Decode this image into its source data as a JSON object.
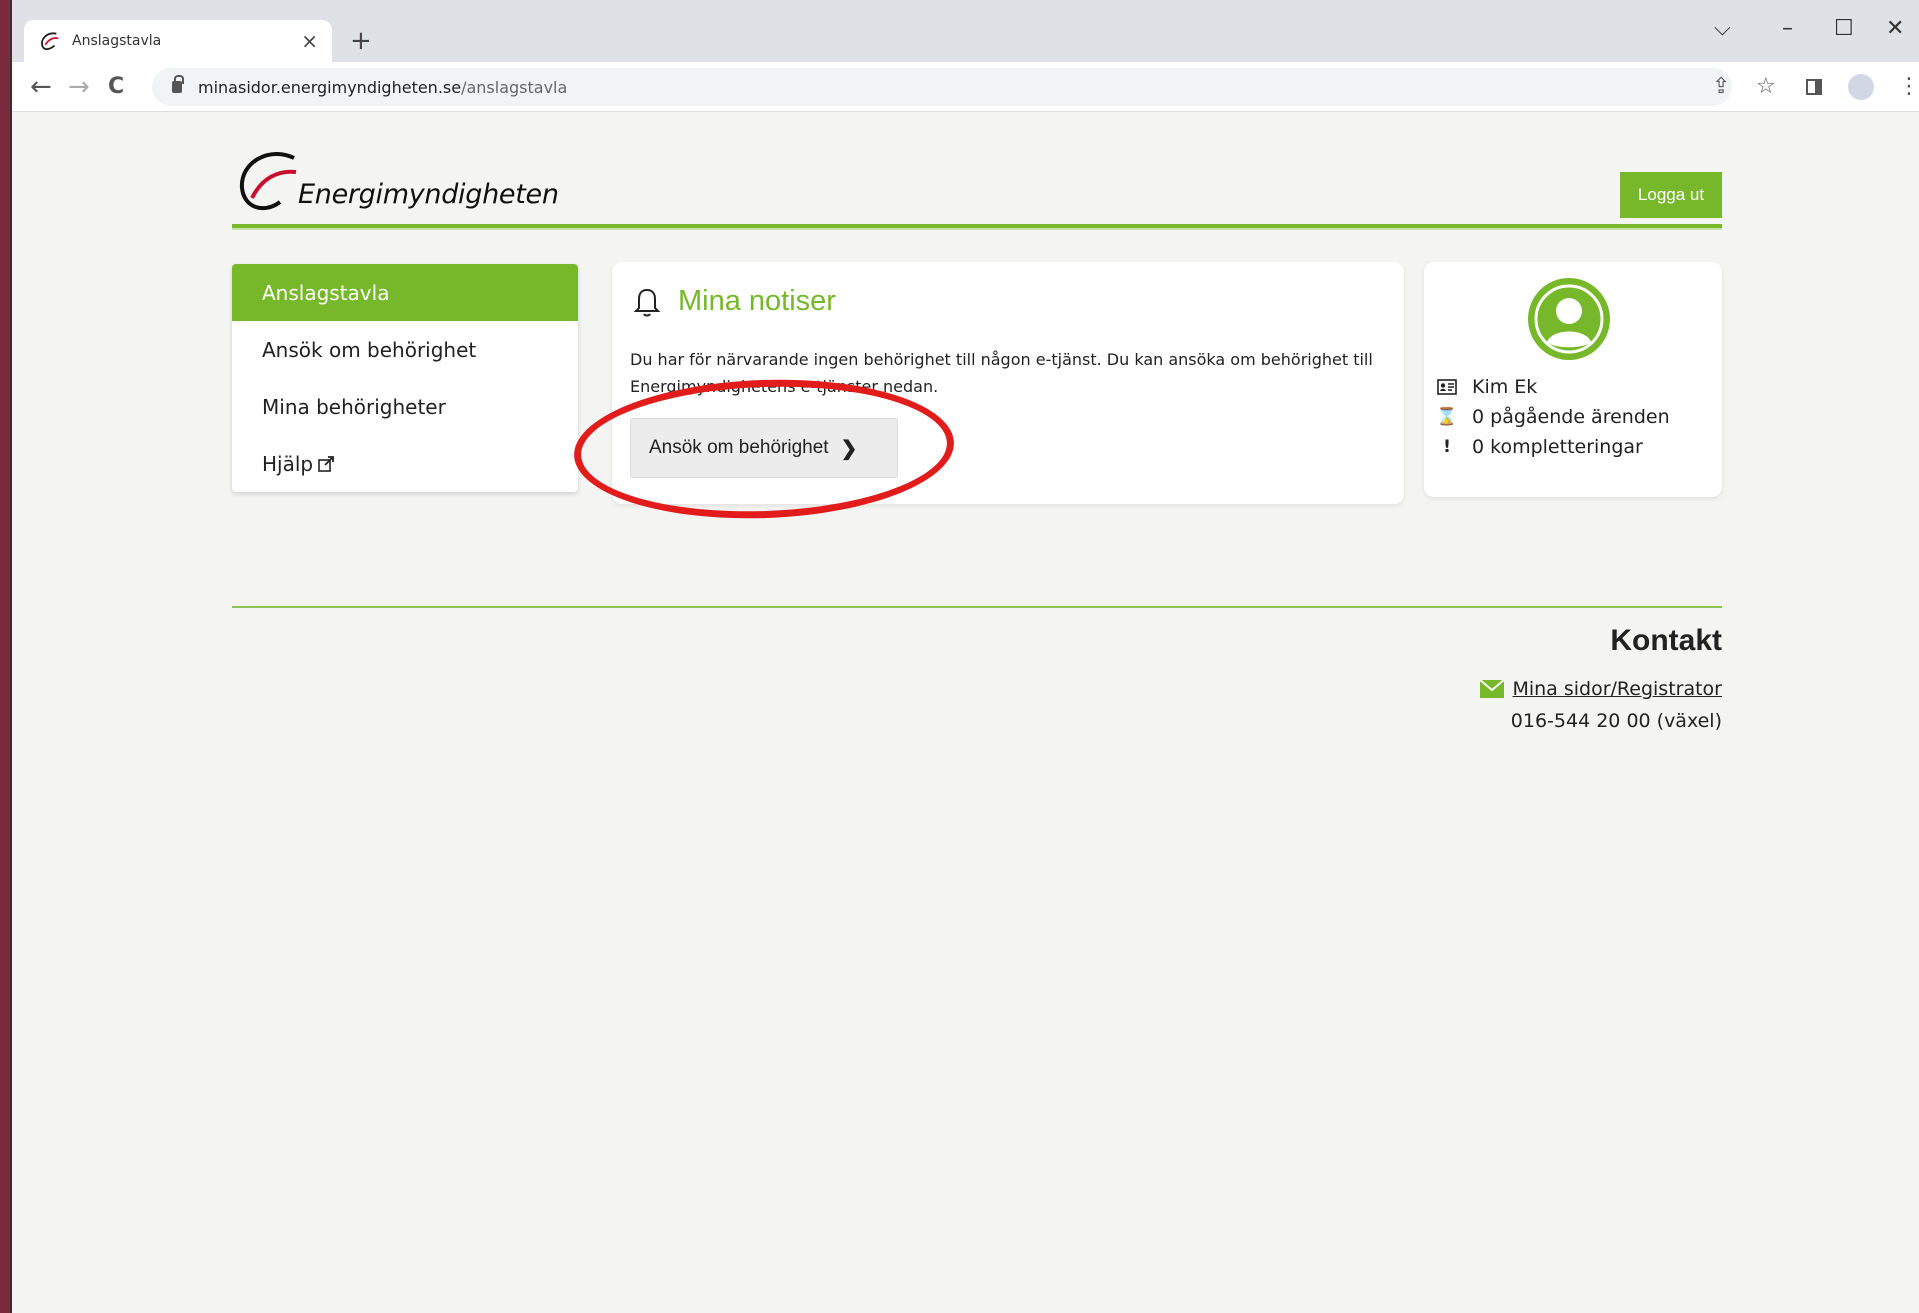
{
  "browser": {
    "tab_title": "Anslagstavla",
    "tab_close": "×",
    "new_tab": "+",
    "url_host": "minasidor.energimyndigheten.se",
    "url_path": "/anslagstavla",
    "win_min": "–",
    "win_max": "☐",
    "win_close": "✕",
    "win_menu": "⌵",
    "back": "←",
    "forward": "→",
    "reload": "C",
    "share": "⇪",
    "star": "☆",
    "more": "⋮"
  },
  "header": {
    "logo_text": "Energimyndigheten",
    "logout_label": "Logga ut"
  },
  "sidebar": {
    "items": [
      {
        "label": "Anslagstavla"
      },
      {
        "label": "Ansök om behörighet"
      },
      {
        "label": "Mina behörigheter"
      },
      {
        "label": "Hjälp"
      }
    ]
  },
  "notices": {
    "title": "Mina notiser",
    "text": "Du har för närvarande ingen behörighet till någon e-tjänst. Du kan ansöka om behörighet till Energimyndighetens e-tjänster nedan.",
    "button_label": "Ansök om behörighet",
    "button_chevron": "❯"
  },
  "profile": {
    "name": "Kim Ek",
    "ongoing": "0 pågående ärenden",
    "completions": "0 kompletteringar",
    "hourglass_glyph": "⌛",
    "exclaim_glyph": "!"
  },
  "contact": {
    "title": "Kontakt",
    "link_label": "Mina sidor/Registrator",
    "phone": "016-544 20 00 (växel)"
  },
  "colors": {
    "brand_green": "#76b82a",
    "highlight_red": "#e21b1b",
    "logo_red": "#c8102e"
  }
}
